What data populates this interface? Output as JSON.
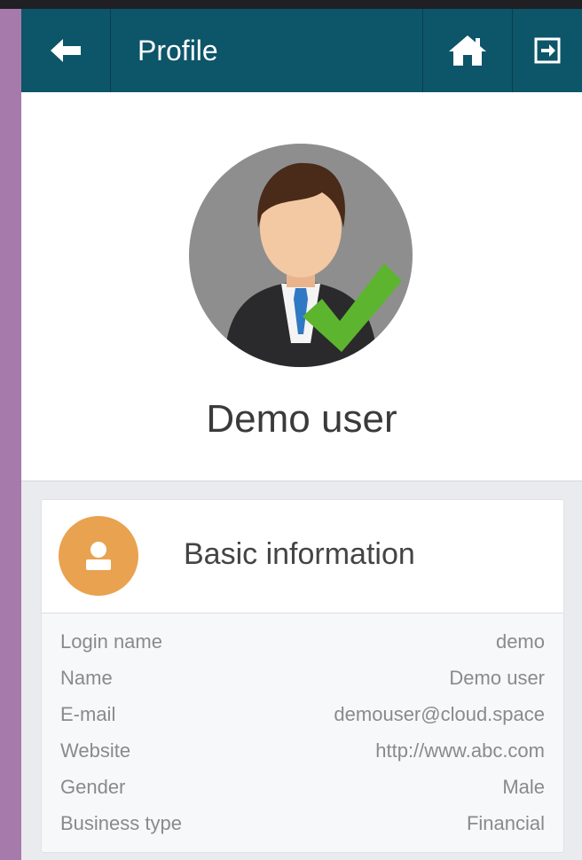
{
  "header": {
    "title": "Profile",
    "back_icon": "arrow-left-icon",
    "home_icon": "home-icon",
    "logout_icon": "logout-icon",
    "bar_color": "#0d5569"
  },
  "profile": {
    "name": "Demo user",
    "avatar_icon": "user-verified-avatar"
  },
  "basic_info": {
    "title": "Basic information",
    "icon": "user-icon",
    "icon_color": "#e9a24f",
    "rows": [
      {
        "label": "Login name",
        "value": "demo"
      },
      {
        "label": "Name",
        "value": "Demo user"
      },
      {
        "label": "E-mail",
        "value": "demouser@cloud.space"
      },
      {
        "label": "Website",
        "value": "http://www.abc.com"
      },
      {
        "label": "Gender",
        "value": "Male"
      },
      {
        "label": "Business type",
        "value": "Financial"
      }
    ]
  }
}
